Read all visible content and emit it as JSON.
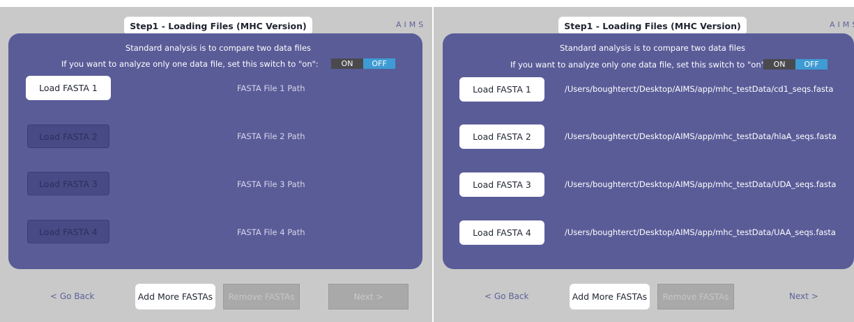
{
  "app": {
    "logo_text": "AIMS"
  },
  "step_title": "Step1 - Loading Files (MHC Version)",
  "instructions": {
    "line1": "Standard analysis is to compare two data files",
    "line2": "If you want to analyze only one data file, set this switch to \"on\":"
  },
  "single_file_switch": {
    "on_label": "ON",
    "off_label": "OFF",
    "selected": "OFF"
  },
  "left_screen": {
    "load_buttons": [
      "Load FASTA 1",
      "Load FASTA 2",
      "Load FASTA 3",
      "Load FASTA 4"
    ],
    "file_paths": [
      "FASTA File 1 Path",
      "FASTA File 2 Path",
      "FASTA File 3 Path",
      "FASTA File 4 Path"
    ],
    "buttons_enabled": [
      true,
      false,
      false,
      false
    ],
    "nav": {
      "back": "< Go Back",
      "add": "Add More FASTAs",
      "remove": "Remove FASTAs",
      "next": "Next >"
    }
  },
  "right_screen": {
    "load_buttons": [
      "Load FASTA 1",
      "Load FASTA 2",
      "Load FASTA 3",
      "Load FASTA 4"
    ],
    "file_paths": [
      "/Users/boughterct/Desktop/AIMS/app/mhc_testData/cd1_seqs.fasta",
      "/Users/boughterct/Desktop/AIMS/app/mhc_testData/hlaA_seqs.fasta",
      "/Users/boughterct/Desktop/AIMS/app/mhc_testData/UDA_seqs.fasta",
      "/Users/boughterct/Desktop/AIMS/app/mhc_testData/UAA_seqs.fasta"
    ],
    "buttons_enabled": [
      true,
      true,
      true,
      true
    ],
    "nav": {
      "back": "< Go Back",
      "add": "Add More FASTAs",
      "remove": "Remove FASTAs",
      "next": "Next >"
    }
  },
  "colors": {
    "panel": "#5a5c98",
    "background": "#c9c9c9",
    "switch_on": "#4a4a4e",
    "switch_off": "#3f9bd3",
    "accent_text": "#5f6199"
  }
}
